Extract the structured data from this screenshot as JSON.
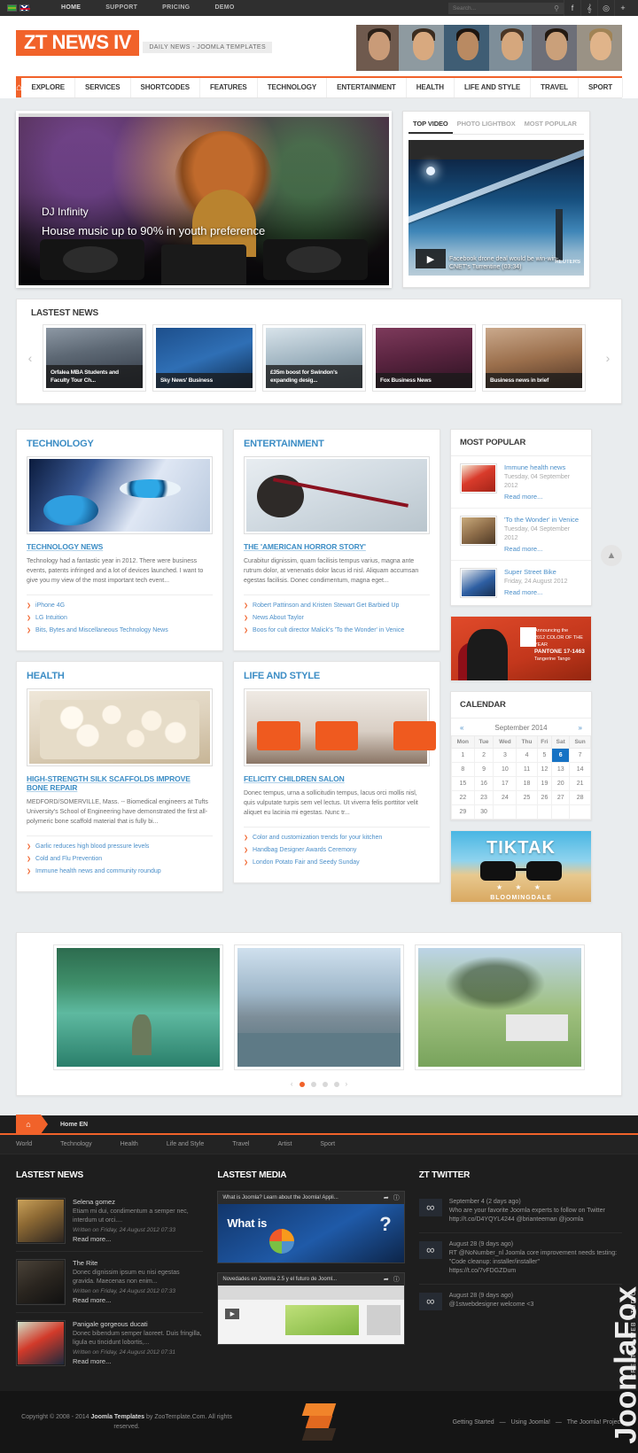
{
  "topbar": {
    "flags": [
      "brazil-flag",
      "uk-flag"
    ],
    "nav": [
      "HOME",
      "SUPPORT",
      "PRICING",
      "DEMO"
    ],
    "search_placeholder": "Search...",
    "social": [
      "f",
      "ᵛ",
      "◉",
      "+"
    ]
  },
  "header": {
    "logo_main": "ZT NEWS IV",
    "logo_sub": "DAILY NEWS - JOOMLA TEMPLATES"
  },
  "mainnav": {
    "home_icon": "home-icon",
    "items": [
      "EXPLORE",
      "SERVICES",
      "SHORTCODES",
      "FEATURES",
      "TECHNOLOGY",
      "ENTERTAINMENT",
      "HEALTH",
      "LIFE AND STYLE",
      "TRAVEL",
      "SPORT"
    ]
  },
  "slider": {
    "title": "DJ Infinity",
    "subtitle": "House music up to 90% in youth preference"
  },
  "videobox": {
    "tabs": [
      "TOP VIDEO",
      "PHOTO LIGHTBOX",
      "MOST POPULAR"
    ],
    "active_tab": "TOP VIDEO",
    "caption": "Facebook drone deal would be win-win- CNET's Turrentine (03:34)",
    "watermark": "REUTERS",
    "play_icon": "play-icon"
  },
  "latest_news": {
    "title": "LASTEST NEWS",
    "prev_icon": "chevron-left-icon",
    "next_icon": "chevron-right-icon",
    "items": [
      {
        "caption": "Orfalea MBA Students and Faculty Tour Ch..."
      },
      {
        "caption": "Sky News' Business"
      },
      {
        "caption": "£35m boost for Swindon's expanding desig..."
      },
      {
        "caption": "Fox Business News"
      },
      {
        "caption": "Business news in brief"
      }
    ]
  },
  "technology": {
    "section_title": "TECHNOLOGY",
    "article_title": "TECHNOLOGY NEWS",
    "article_text": "Technology had a fantastic year in 2012. There were business events, patents infringed and a lot of devices launched. I want to give you my view of the most important tech event...",
    "links": [
      "iPhone 4G",
      "LG Intuition",
      "Bits, Bytes and Miscellaneous Technology News"
    ]
  },
  "entertainment": {
    "section_title": "ENTERTAINMENT",
    "article_title": "THE 'AMERICAN HORROR STORY'",
    "article_text": "Curabitur dignissim, quam facilisis tempus varius, magna ante rutrum dolor, at venenatis dolor lacus id nisl. Aliquam accumsan egestas facilisis. Donec condimentum, magna eget...",
    "links": [
      "Robert Pattinson and Kristen Stewart Get Barbied Up",
      "News About Taylor",
      "Boos for cult director Malick's 'To the Wonder' in Venice"
    ]
  },
  "health": {
    "section_title": "HEALTH",
    "article_title": "HIGH-STRENGTH SILK SCAFFOLDS IMPROVE BONE REPAIR",
    "article_text": "MEDFORD/SOMERVILLE, Mass. -- Biomedical engineers at Tufts University's School of Engineering have demonstrated the first all-polymeric bone scaffold material that is fully bi...",
    "links": [
      "Garlic reduces high blood pressure levels",
      "Cold and Flu Prevention",
      "Immune health news and community roundup"
    ]
  },
  "lifeandstyle": {
    "section_title": "LIFE AND STYLE",
    "article_title": "FELICITY CHILDREN SALON",
    "article_text": "Donec tempus, urna a sollicitudin tempus, lacus orci mollis nisl, quis vulputate turpis sem vel lectus. Ut viverra felis porttitor velit aliquet eu lacinia mi egestas. Nunc tr...",
    "links": [
      "Color and customization trends for your kitchen",
      "Handbag Designer Awards Ceremony",
      "London Potato Fair and Seedy Sunday"
    ]
  },
  "most_popular": {
    "title": "MOST POPULAR",
    "items": [
      {
        "title": "Immune health news",
        "date": "Tuesday, 04 September 2012",
        "more": "Read more..."
      },
      {
        "title": "'To the Wonder' in Venice",
        "date": "Tuesday, 04 September 2012",
        "more": "Read more..."
      },
      {
        "title": "Super Street Bike",
        "date": "Friday, 24 August 2012",
        "more": "Read more..."
      }
    ]
  },
  "ad_tango": {
    "line1": "Announcing the",
    "line2": "2012 COLOR OF THE YEAR",
    "line3": "PANTONE 17-1463",
    "line4": "Tangerine Tango"
  },
  "calendar": {
    "title": "CALENDAR",
    "prev_icon": "double-chevron-left-icon",
    "next_icon": "double-chevron-right-icon",
    "month": "September 2014",
    "weekdays": [
      "Mon",
      "Tue",
      "Wed",
      "Thu",
      "Fri",
      "Sat",
      "Sun"
    ],
    "weeks": [
      [
        "1",
        "2",
        "3",
        "4",
        "5",
        "6",
        "7"
      ],
      [
        "8",
        "9",
        "10",
        "11",
        "12",
        "13",
        "14"
      ],
      [
        "15",
        "16",
        "17",
        "18",
        "19",
        "20",
        "21"
      ],
      [
        "22",
        "23",
        "24",
        "25",
        "26",
        "27",
        "28"
      ],
      [
        "29",
        "30",
        "",
        "",
        "",
        "",
        ""
      ]
    ],
    "today": "6"
  },
  "ad_tiktak": {
    "brand": "TIKTAK",
    "stars": "★ ★ ★",
    "footer": "BLOOMINGDALE"
  },
  "scroll_top_icon": "scroll-to-top-icon",
  "gallery": {
    "prev_icon": "chevron-left-icon",
    "next_icon": "chevron-right-icon",
    "dots": 4,
    "active_dot": 1
  },
  "breadcrumb": {
    "home_icon": "home-icon",
    "label": "Home EN"
  },
  "footnav": [
    "World",
    "Technology",
    "Health",
    "Life and Style",
    "Travel",
    "Artist",
    "Sport"
  ],
  "footer_news": {
    "title": "LASTEST NEWS",
    "items": [
      {
        "title": "Selena gomez",
        "text": "Etiam mi dui, condimentum a semper nec, interdum ut orci....",
        "written": "Written on Friday, 24 August 2012 07:33",
        "more": "Read more..."
      },
      {
        "title": "The Rite",
        "text": "Donec dignissim ipsum eu nisi egestas gravida. Maecenas non enim...",
        "written": "Written on Friday, 24 August 2012 07:33",
        "more": "Read more..."
      },
      {
        "title": "Panigale gorgeous ducati",
        "text": "Donec bibendum semper laoreet. Duis fringilla, ligula eu tincidunt lobortis,...",
        "written": "Written on Friday, 24 August 2012 07:31",
        "more": "Read more..."
      }
    ]
  },
  "footer_media": {
    "title": "LASTEST MEDIA",
    "items": [
      {
        "caption": "What is Joomla? Learn about the Joomla! Appli...",
        "share_icon": "share-icon",
        "info_icon": "info-icon"
      },
      {
        "caption": "Novedades en Joomla 2.5 y el futuro de Jooml...",
        "share_icon": "share-icon",
        "info_icon": "info-icon"
      }
    ]
  },
  "footer_twitter": {
    "title": "ZT TWITTER",
    "items": [
      {
        "date": "September 4 (2 days ago)",
        "text": "Who are your favorite Joomla experts to follow on Twitter",
        "links": "http://t.co/D4YQYL4244 @brianteeman @joomla"
      },
      {
        "date": "August 28 (9 days ago)",
        "text": "RT @NoNumber_nl Joomla core improvement needs testing: \"Code cleanup: installer/installer\"",
        "links": "https://t.co/7vFDGZDum"
      },
      {
        "date": "August 28 (9 days ago)",
        "text": "@1stwebdesigner welcome <3",
        "links": ""
      }
    ]
  },
  "watermark": {
    "text": "JoomlaFox",
    "sub": "CREATIVE WEB STUDIO"
  },
  "copyright": {
    "text_pre": "Copyright © 2008 - 2014 ",
    "text_bold": "Joomla Templates",
    "text_post": " by ZooTemplate.Com. All rights reserved.",
    "links": [
      "Getting Started",
      "Using Joomla!",
      "The Joomla! Project"
    ],
    "separator": "—"
  },
  "colors": {
    "accent": "#f1622a",
    "link_blue": "#4b8fc9",
    "heading_blue": "#3c8dc5",
    "dark": "#1e1e1e",
    "calendar_today": "#1672c4"
  }
}
